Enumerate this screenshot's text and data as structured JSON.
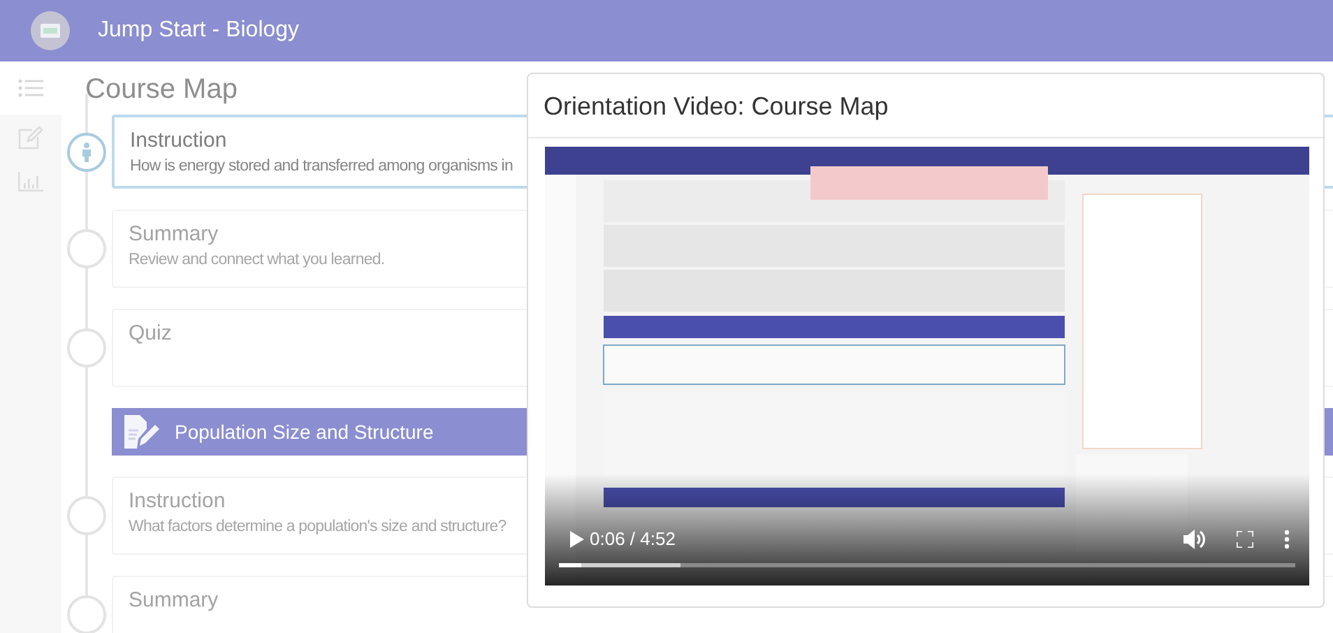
{
  "app": {
    "title": "Jump Start - Biology"
  },
  "sidebar": {
    "items": [
      {
        "kind": "list",
        "selected": true
      },
      {
        "kind": "edit",
        "selected": false
      },
      {
        "kind": "chart",
        "selected": false
      }
    ]
  },
  "page_title": "Course Map",
  "timeline": [
    {
      "kind": "activity",
      "title": "Instruction",
      "subtitle": "How is energy stored and transferred among organisms in",
      "current": true
    },
    {
      "kind": "activity",
      "title": "Summary",
      "subtitle": "Review and connect what you learned.",
      "current": false
    },
    {
      "kind": "activity",
      "title": "Quiz",
      "current": false
    },
    {
      "kind": "section",
      "title": "Population Size and Structure"
    },
    {
      "kind": "activity",
      "title": "Instruction",
      "subtitle": "What factors determine a population's size and structure?",
      "current": false
    },
    {
      "kind": "activity",
      "title": "Summary",
      "current": false
    }
  ],
  "modal": {
    "title": "Orientation Video: Course Map",
    "video": {
      "kind": "picture",
      "time": "0:06 / 4:52",
      "progress": {
        "level": 0.03
      },
      "buffer": {
        "level": 0.165
      }
    }
  }
}
